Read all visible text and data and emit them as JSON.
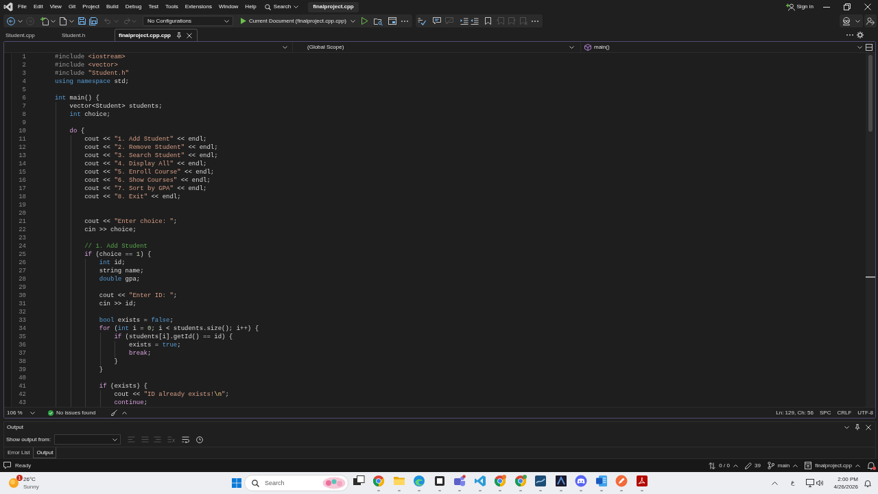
{
  "menu_bar": {
    "items": [
      "File",
      "Edit",
      "View",
      "Git",
      "Project",
      "Build",
      "Debug",
      "Test",
      "Tools",
      "Extensions",
      "Window",
      "Help"
    ],
    "search": "Search",
    "solution_title": "finalproject.cpp",
    "sign_in": "Sign in"
  },
  "toolbar": {
    "configuration": "No Configurations",
    "run_target": "Current Document (finalproject.cpp.cpp)"
  },
  "tabs": [
    {
      "label": "Student.cpp",
      "selected": false
    },
    {
      "label": "Student.h",
      "selected": false
    },
    {
      "label": "finalproject.cpp.cpp",
      "selected": true
    }
  ],
  "navigation_bar": {
    "scope": "(Global Scope)",
    "member": "main()"
  },
  "editor": {
    "lines": [
      {
        "number": "1",
        "tokens": [
          {
            "kind": "pre",
            "text": "#include "
          },
          {
            "kind": "str",
            "text": "<iostream>"
          }
        ]
      },
      {
        "number": "2",
        "tokens": [
          {
            "kind": "pre",
            "text": "#include "
          },
          {
            "kind": "str",
            "text": "<vector>"
          }
        ]
      },
      {
        "number": "3",
        "tokens": [
          {
            "kind": "pre",
            "text": "#include "
          },
          {
            "kind": "str",
            "text": "\"Student.h\""
          }
        ]
      },
      {
        "number": "4",
        "tokens": [
          {
            "kind": "kw",
            "text": "using namespace"
          },
          {
            "kind": "plain",
            "text": " std;"
          }
        ]
      },
      {
        "number": "5"
      },
      {
        "number": "6",
        "tokens": [
          {
            "kind": "kw",
            "text": "int"
          },
          {
            "kind": "plain",
            "text": " main() {"
          }
        ]
      },
      {
        "number": "7",
        "tokens": [
          {
            "kind": "plain",
            "text": "    vector<Student> students;"
          }
        ]
      },
      {
        "number": "8",
        "tokens": [
          {
            "kind": "kw",
            "text": "    int"
          },
          {
            "kind": "plain",
            "text": " choice;"
          }
        ]
      },
      {
        "number": "9"
      },
      {
        "number": "10",
        "tokens": [
          {
            "kind": "ctl",
            "text": "    do"
          },
          {
            "kind": "plain",
            "text": " {"
          }
        ]
      },
      {
        "number": "11",
        "tokens": [
          {
            "kind": "plain",
            "text": "        cout << "
          },
          {
            "kind": "str",
            "text": "\"1. Add Student\""
          },
          {
            "kind": "plain",
            "text": " << endl;"
          }
        ]
      },
      {
        "number": "12",
        "tokens": [
          {
            "kind": "plain",
            "text": "        cout << "
          },
          {
            "kind": "str",
            "text": "\"2. Remove Student\""
          },
          {
            "kind": "plain",
            "text": " << endl;"
          }
        ]
      },
      {
        "number": "13",
        "tokens": [
          {
            "kind": "plain",
            "text": "        cout << "
          },
          {
            "kind": "str",
            "text": "\"3. Search Student\""
          },
          {
            "kind": "plain",
            "text": " << endl;"
          }
        ]
      },
      {
        "number": "14",
        "tokens": [
          {
            "kind": "plain",
            "text": "        cout << "
          },
          {
            "kind": "str",
            "text": "\"4. Display All\""
          },
          {
            "kind": "plain",
            "text": " << endl;"
          }
        ]
      },
      {
        "number": "15",
        "tokens": [
          {
            "kind": "plain",
            "text": "        cout << "
          },
          {
            "kind": "str",
            "text": "\"5. Enroll Course\""
          },
          {
            "kind": "plain",
            "text": " << endl;"
          }
        ]
      },
      {
        "number": "16",
        "tokens": [
          {
            "kind": "plain",
            "text": "        cout << "
          },
          {
            "kind": "str",
            "text": "\"6. Show Courses\""
          },
          {
            "kind": "plain",
            "text": " << endl;"
          }
        ]
      },
      {
        "number": "17",
        "tokens": [
          {
            "kind": "plain",
            "text": "        cout << "
          },
          {
            "kind": "str",
            "text": "\"7. Sort by GPA\""
          },
          {
            "kind": "plain",
            "text": " << endl;"
          }
        ]
      },
      {
        "number": "18",
        "tokens": [
          {
            "kind": "plain",
            "text": "        cout << "
          },
          {
            "kind": "str",
            "text": "\"8. Exit\""
          },
          {
            "kind": "plain",
            "text": " << endl;"
          }
        ]
      },
      {
        "number": "19"
      },
      {
        "number": "20"
      },
      {
        "number": "21",
        "tokens": [
          {
            "kind": "plain",
            "text": "        cout << "
          },
          {
            "kind": "str",
            "text": "\"Enter choice: \""
          },
          {
            "kind": "plain",
            "text": ";"
          }
        ]
      },
      {
        "number": "22",
        "tokens": [
          {
            "kind": "plain",
            "text": "        cin >> choice;"
          }
        ]
      },
      {
        "number": "23"
      },
      {
        "number": "24",
        "tokens": [
          {
            "kind": "cmt",
            "text": "        // 1. Add Student"
          }
        ]
      },
      {
        "number": "25",
        "tokens": [
          {
            "kind": "ctl",
            "text": "        if"
          },
          {
            "kind": "plain",
            "text": " (choice == "
          },
          {
            "kind": "num",
            "text": "1"
          },
          {
            "kind": "plain",
            "text": ") {"
          }
        ]
      },
      {
        "number": "26",
        "tokens": [
          {
            "kind": "kw",
            "text": "            int"
          },
          {
            "kind": "plain",
            "text": " id;"
          }
        ]
      },
      {
        "number": "27",
        "tokens": [
          {
            "kind": "plain",
            "text": "            string name;"
          }
        ]
      },
      {
        "number": "28",
        "tokens": [
          {
            "kind": "kw",
            "text": "            double"
          },
          {
            "kind": "plain",
            "text": " gpa;"
          }
        ]
      },
      {
        "number": "29"
      },
      {
        "number": "30",
        "tokens": [
          {
            "kind": "plain",
            "text": "            cout << "
          },
          {
            "kind": "str",
            "text": "\"Enter ID: \""
          },
          {
            "kind": "plain",
            "text": ";"
          }
        ]
      },
      {
        "number": "31",
        "tokens": [
          {
            "kind": "plain",
            "text": "            cin >> id;"
          }
        ]
      },
      {
        "number": "32"
      },
      {
        "number": "33",
        "tokens": [
          {
            "kind": "kw",
            "text": "            bool"
          },
          {
            "kind": "plain",
            "text": " exists = "
          },
          {
            "kind": "kw",
            "text": "false"
          },
          {
            "kind": "plain",
            "text": ";"
          }
        ]
      },
      {
        "number": "34",
        "tokens": [
          {
            "kind": "ctl",
            "text": "            for"
          },
          {
            "kind": "plain",
            "text": " ("
          },
          {
            "kind": "kw",
            "text": "int"
          },
          {
            "kind": "plain",
            "text": " i = "
          },
          {
            "kind": "num",
            "text": "0"
          },
          {
            "kind": "plain",
            "text": "; i < students.size(); i++) {"
          }
        ]
      },
      {
        "number": "35",
        "tokens": [
          {
            "kind": "ctl",
            "text": "                if"
          },
          {
            "kind": "plain",
            "text": " (students[i].getId() == id) {"
          }
        ]
      },
      {
        "number": "36",
        "tokens": [
          {
            "kind": "plain",
            "text": "                    exists = "
          },
          {
            "kind": "kw",
            "text": "true"
          },
          {
            "kind": "plain",
            "text": ";"
          }
        ]
      },
      {
        "number": "37",
        "tokens": [
          {
            "kind": "ctl",
            "text": "                    break"
          },
          {
            "kind": "plain",
            "text": ";"
          }
        ]
      },
      {
        "number": "38",
        "tokens": [
          {
            "kind": "plain",
            "text": "                }"
          }
        ]
      },
      {
        "number": "39",
        "tokens": [
          {
            "kind": "plain",
            "text": "            }"
          }
        ]
      },
      {
        "number": "40"
      },
      {
        "number": "41",
        "tokens": [
          {
            "kind": "ctl",
            "text": "            if"
          },
          {
            "kind": "plain",
            "text": " (exists) {"
          }
        ]
      },
      {
        "number": "42",
        "tokens": [
          {
            "kind": "plain",
            "text": "                cout << "
          },
          {
            "kind": "str",
            "text": "\"ID already exists!"
          },
          {
            "kind": "esc",
            "text": "\\n"
          },
          {
            "kind": "str",
            "text": "\""
          },
          {
            "kind": "plain",
            "text": ";"
          }
        ]
      },
      {
        "number": "43",
        "tokens": [
          {
            "kind": "ctl",
            "text": "                continue"
          },
          {
            "kind": "plain",
            "text": ";"
          }
        ]
      }
    ]
  },
  "editor_status": {
    "zoom": "106 %",
    "issues": "No issues found",
    "position": "Ln: 129, Ch: 56",
    "indentation": "SPC",
    "line_ending": "CRLF",
    "encoding": "UTF-8"
  },
  "output_panel": {
    "title": "Output",
    "source_label": "Show output from:",
    "tabs": [
      {
        "label": "Error List",
        "selected": false
      },
      {
        "label": "Output",
        "selected": true
      }
    ]
  },
  "status_bar": {
    "message": "Ready",
    "changes": "0 / 0",
    "edits": "39",
    "branch": "main",
    "repository": "finalproject.cpp"
  },
  "taskbar": {
    "weather": {
      "badge": "1",
      "temperature": "26°C",
      "condition": "Sunny"
    },
    "search": {
      "placeholder": "Search"
    },
    "language": "ع",
    "time": "2:00 PM",
    "date": "4/26/2026"
  }
}
